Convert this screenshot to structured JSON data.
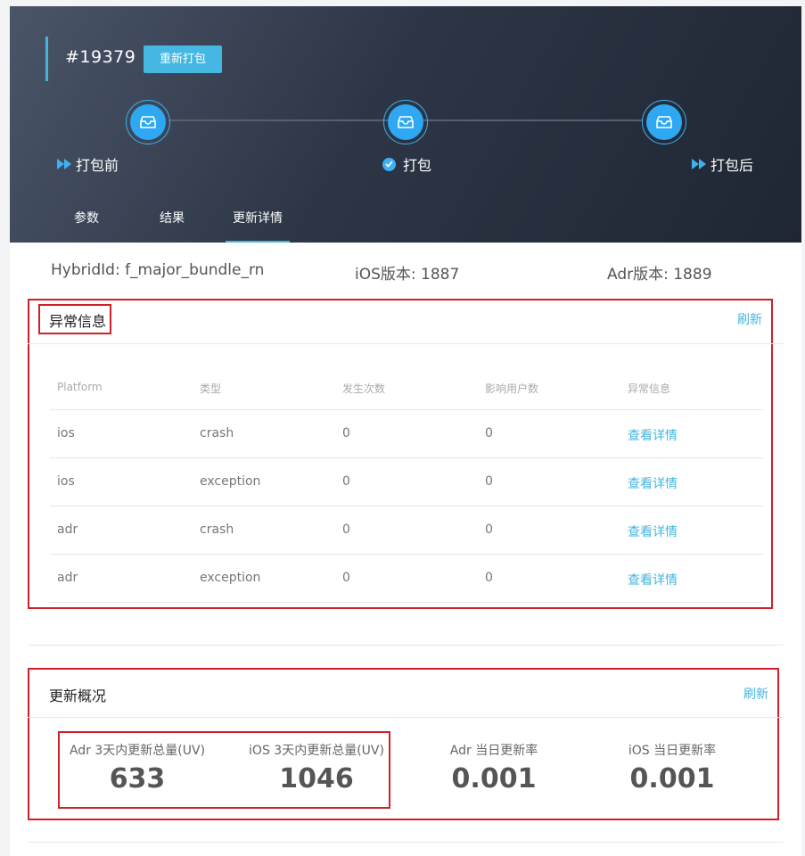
{
  "header": {
    "build_id": "#19379",
    "rebuild_label": "重新打包",
    "steps": [
      {
        "label": "打包前",
        "status_icon": "double-arrow-icon"
      },
      {
        "label": "打包",
        "status_icon": "check-circle-icon"
      },
      {
        "label": "打包后",
        "status_icon": "double-arrow-icon"
      }
    ],
    "tabs": [
      {
        "label": "参数"
      },
      {
        "label": "结果"
      },
      {
        "label": "更新详情"
      }
    ],
    "active_tab": "更新详情"
  },
  "meta": {
    "hybrid_id": "HybridId: f_major_bundle_rn",
    "ios_version": "iOS版本: 1887",
    "adr_version": "Adr版本: 1889"
  },
  "exceptions": {
    "title": "异常信息",
    "refresh_label": "刷新",
    "columns": [
      "Platform",
      "类型",
      "发生次数",
      "影响用户数",
      "异常信息"
    ],
    "rows": [
      {
        "platform": "ios",
        "type": "crash",
        "count": "0",
        "users": "0",
        "link": "查看详情"
      },
      {
        "platform": "ios",
        "type": "exception",
        "count": "0",
        "users": "0",
        "link": "查看详情"
      },
      {
        "platform": "adr",
        "type": "crash",
        "count": "0",
        "users": "0",
        "link": "查看详情"
      },
      {
        "platform": "adr",
        "type": "exception",
        "count": "0",
        "users": "0",
        "link": "查看详情"
      }
    ]
  },
  "overview": {
    "title": "更新概况",
    "refresh_label": "刷新",
    "stats": [
      {
        "label": "Adr 3天内更新总量(UV)",
        "value": "633"
      },
      {
        "label": "iOS 3天内更新总量(UV)",
        "value": "1046"
      },
      {
        "label": "Adr 当日更新率",
        "value": "0.001"
      },
      {
        "label": "iOS 当日更新率",
        "value": "0.001"
      }
    ]
  },
  "colors": {
    "accent": "#44b5e0",
    "highlight_box": "#d0202a",
    "header_dark": "#1f2633"
  }
}
